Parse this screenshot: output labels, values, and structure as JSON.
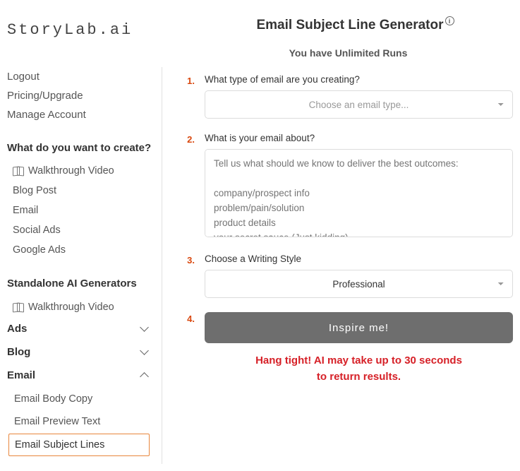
{
  "brand": "StoryLab.ai",
  "topnav": {
    "logout": "Logout",
    "pricing": "Pricing/Upgrade",
    "manage": "Manage Account"
  },
  "create": {
    "heading": "What do you want to create?",
    "walkthrough": "Walkthrough Video",
    "blog_post": "Blog Post",
    "email": "Email",
    "social_ads": "Social Ads",
    "google_ads": "Google Ads"
  },
  "standalone": {
    "heading": "Standalone AI Generators",
    "walkthrough": "Walkthrough Video"
  },
  "acc": {
    "ads": "Ads",
    "blog": "Blog",
    "email": "Email",
    "email_body": "Email Body Copy",
    "email_preview": "Email Preview Text",
    "email_subject": "Email Subject Lines"
  },
  "page": {
    "title": "Email Subject Line Generator",
    "runs": "You have Unlimited Runs"
  },
  "form": {
    "step1_num": "1.",
    "step1_label": "What type of email are you creating?",
    "step1_placeholder": "Choose an email type...",
    "step2_num": "2.",
    "step2_label": "What is your email about?",
    "step2_placeholder": "Tell us what should we know to deliver the best outcomes:\n\ncompany/prospect info\nproblem/pain/solution\nproduct details\nyour secret sauce (Just kidding)",
    "step3_num": "3.",
    "step3_label": "Choose a Writing Style",
    "step3_value": "Professional",
    "step4_num": "4.",
    "button": "Inspire me!",
    "wait_l1": "Hang tight! AI may take up to 30 seconds",
    "wait_l2": "to return results."
  }
}
